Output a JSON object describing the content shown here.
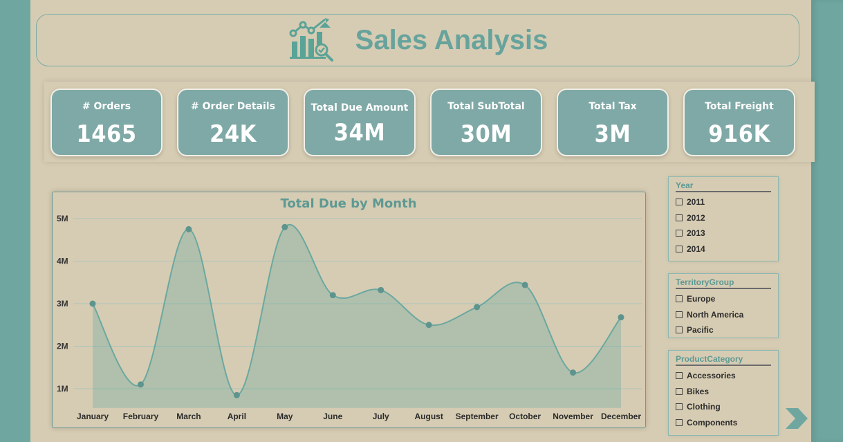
{
  "header": {
    "title": "Sales Analysis",
    "logo_icon": "chart-analytics-icon"
  },
  "kpis": [
    {
      "label": "# Orders",
      "value": "1465"
    },
    {
      "label": "# Order Details",
      "value": "24K"
    },
    {
      "label": "Total Due Amount",
      "value": "34M"
    },
    {
      "label": "Total SubTotal",
      "value": "30M"
    },
    {
      "label": "Total Tax",
      "value": "3M"
    },
    {
      "label": "Total Freight",
      "value": "916K"
    }
  ],
  "chart_data": {
    "type": "area",
    "title": "Total Due by Month",
    "xlabel": "",
    "ylabel": "",
    "categories": [
      "January",
      "February",
      "March",
      "April",
      "May",
      "June",
      "July",
      "August",
      "September",
      "October",
      "November",
      "December"
    ],
    "values": [
      3.0,
      1.1,
      4.75,
      0.85,
      4.8,
      3.2,
      3.32,
      2.5,
      2.92,
      3.44,
      1.38,
      2.68
    ],
    "yticks": [
      "1M",
      "2M",
      "3M",
      "4M",
      "5M"
    ],
    "ylim": [
      0.5,
      5.0
    ],
    "grid": true,
    "color": "#6aa8a0"
  },
  "slicers": {
    "year": {
      "title": "Year",
      "items": [
        "2011",
        "2012",
        "2013",
        "2014"
      ]
    },
    "territory": {
      "title": "TerritoryGroup",
      "items": [
        "Europe",
        "North America",
        "Pacific"
      ]
    },
    "category": {
      "title": "ProductCategory",
      "items": [
        "Accessories",
        "Bikes",
        "Clothing",
        "Components"
      ]
    }
  },
  "colors": {
    "accent": "#67a39c",
    "background": "#d6ccb3",
    "card": "#7fa9a6",
    "side": "#6fa7a0"
  },
  "nav": {
    "next_icon": "chevron-right-icon"
  }
}
